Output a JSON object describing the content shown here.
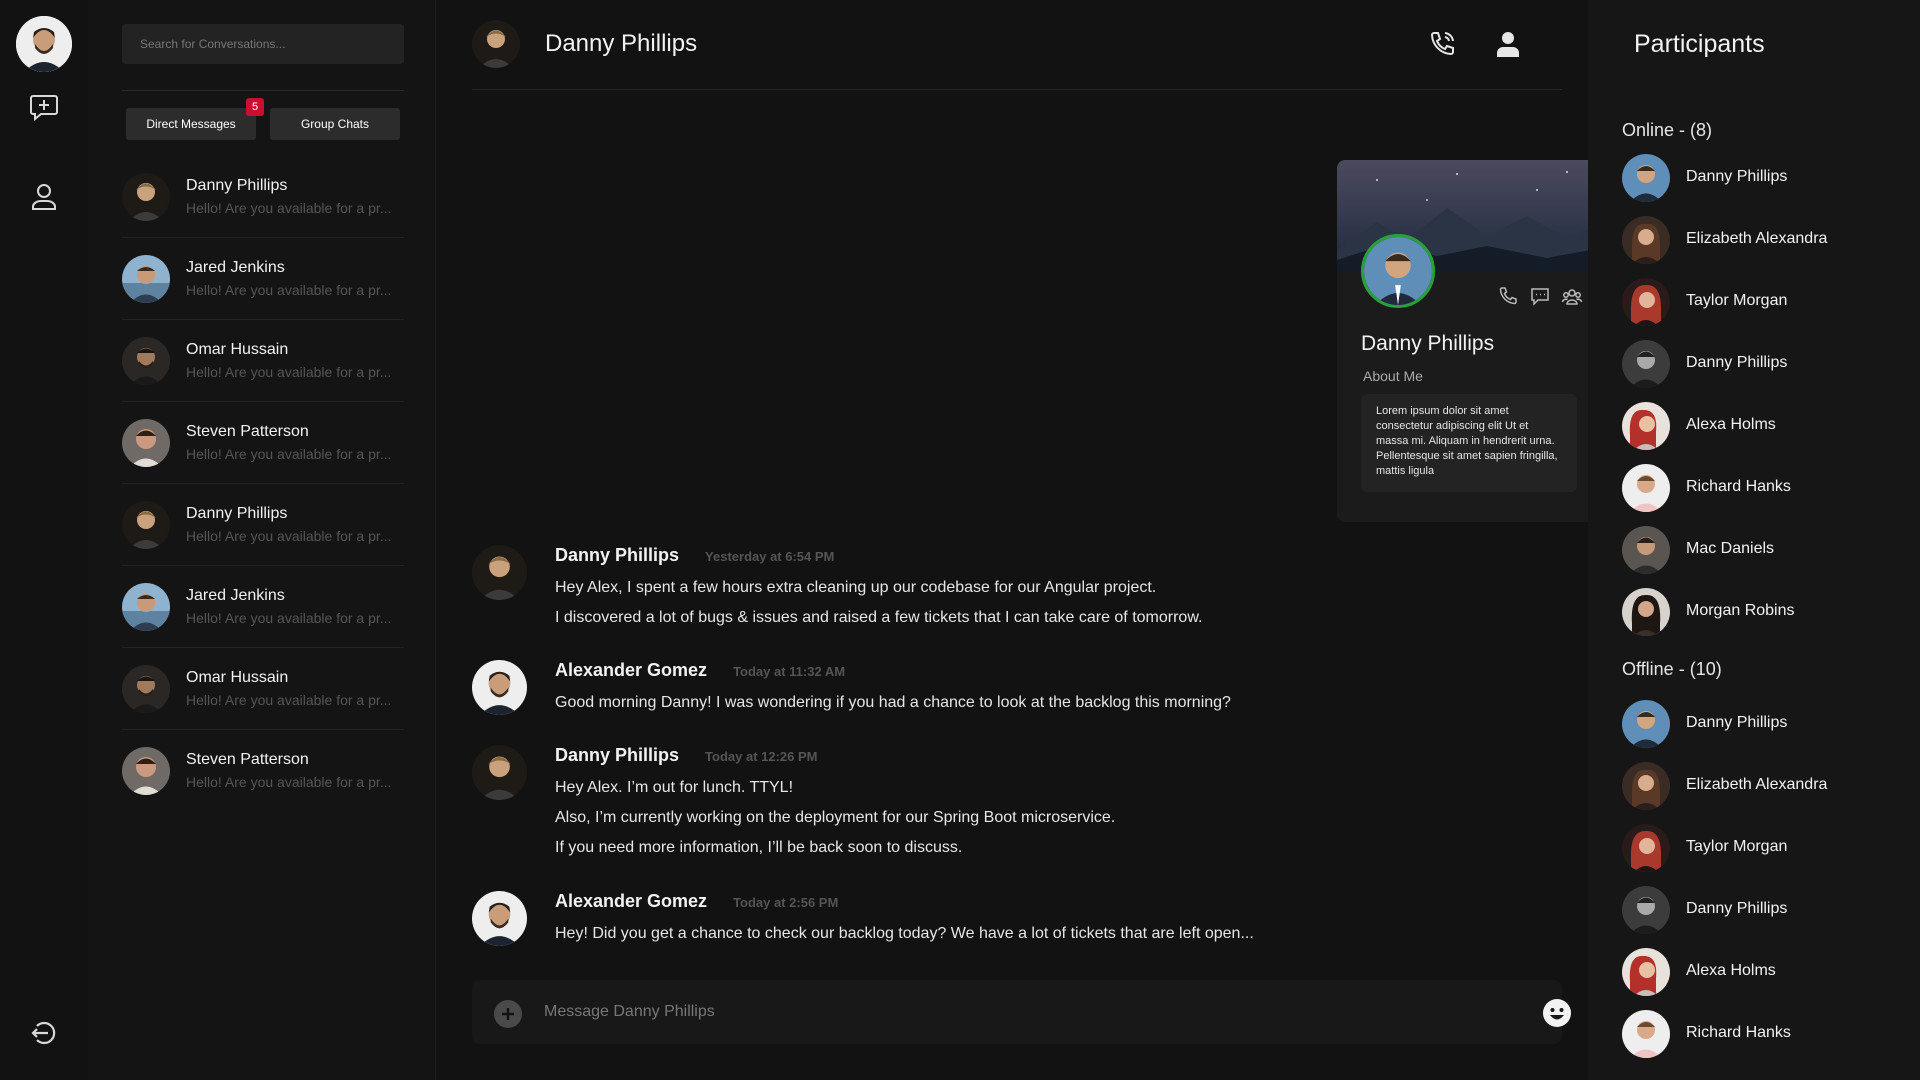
{
  "search": {
    "placeholder": "Search for Conversations..."
  },
  "tabs": [
    {
      "label": "Direct Messages",
      "badge": "5"
    },
    {
      "label": "Group Chats"
    }
  ],
  "conversations": [
    {
      "name": "Danny Phillips",
      "preview": "Hello! Are you available for a pr..."
    },
    {
      "name": "Jared Jenkins",
      "preview": "Hello! Are you available for a pr..."
    },
    {
      "name": "Omar Hussain",
      "preview": "Hello! Are you available for a pr..."
    },
    {
      "name": "Steven Patterson",
      "preview": "Hello! Are you available for a pr..."
    },
    {
      "name": "Danny Phillips",
      "preview": "Hello! Are you available for a pr..."
    },
    {
      "name": "Jared Jenkins",
      "preview": "Hello! Are you available for a pr..."
    },
    {
      "name": "Omar Hussain",
      "preview": "Hello! Are you available for a pr..."
    },
    {
      "name": "Steven Patterson",
      "preview": "Hello! Are you available for a pr..."
    }
  ],
  "chat": {
    "title": "Danny Phillips",
    "messages": [
      {
        "sender": "Danny Phillips",
        "time": "Yesterday at 6:54 PM",
        "lines": [
          "Hey Alex, I spent a few hours extra cleaning up our codebase for our Angular project.",
          "I discovered a lot of bugs & issues and raised a few tickets that I can take care of tomorrow."
        ]
      },
      {
        "sender": "Alexander Gomez",
        "time": "Today at 11:32 AM",
        "lines": [
          "Good morning Danny! I was wondering if you had a chance to look at the backlog this morning?"
        ]
      },
      {
        "sender": "Danny Phillips",
        "time": "Today at 12:26 PM",
        "lines": [
          "Hey Alex. I’m out for lunch. TTYL!",
          "Also, I’m currently working on the deployment for our Spring Boot microservice.",
          "If you need more information, I’ll be back soon to discuss."
        ]
      },
      {
        "sender": "Alexander Gomez",
        "time": "Today at 2:56 PM",
        "lines": [
          "Hey! Did you get a chance to check our backlog today? We have a lot of tickets that are left open..."
        ]
      }
    ],
    "composer_placeholder": "Message Danny Phillips"
  },
  "profile_card": {
    "name": "Danny Phillips",
    "about_label": "About Me",
    "about_text": "Lorem ipsum dolor sit amet consectetur adipiscing elit Ut et massa mi. Aliquam in hendrerit urna. Pellentesque sit amet sapien fringilla, mattis ligula"
  },
  "participants": {
    "title": "Participants",
    "online_label": "Online - (8)",
    "online": [
      "Danny Phillips",
      "Elizabeth Alexandra",
      "Taylor Morgan",
      "Danny Phillips",
      "Alexa Holms",
      "Richard Hanks",
      "Mac Daniels",
      "Morgan Robins"
    ],
    "offline_label": "Offline - (10)",
    "offline": [
      "Danny Phillips",
      "Elizabeth Alexandra",
      "Taylor Morgan",
      "Danny Phillips",
      "Alexa Holms",
      "Richard Hanks"
    ]
  },
  "colors": {
    "accent_badge": "#c8102e",
    "online_ring": "#27a23a",
    "background": "#121212"
  },
  "icons": [
    "add-chat-icon",
    "user-icon",
    "logout-icon",
    "phone-call-icon",
    "person-icon",
    "plus-icon",
    "emoji-icon",
    "phone-icon",
    "message-icon",
    "group-icon"
  ]
}
